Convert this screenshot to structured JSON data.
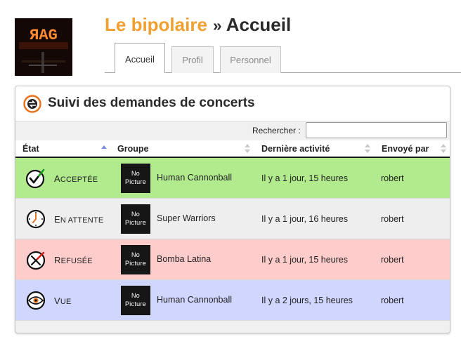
{
  "header": {
    "logo_text": "ЯAG",
    "venue": "Le bipolaire",
    "separator": "»",
    "page": "Accueil"
  },
  "tabs": [
    {
      "label": "Accueil",
      "active": true
    },
    {
      "label": "Profil",
      "active": false
    },
    {
      "label": "Personnel",
      "active": false
    }
  ],
  "panel": {
    "title": "Suivi des demandes de concerts",
    "search": {
      "label": "Rechercher :",
      "value": "",
      "placeholder": ""
    },
    "columns": [
      "État",
      "Groupe",
      "Dernière activité",
      "Envoyé par"
    ],
    "rows": [
      {
        "status_initial": "A",
        "status_rest": "CCEPTÉE",
        "status_icon": "accepted-check-icon",
        "thumb": [
          "No",
          "Picture"
        ],
        "group": "Human Cannonball",
        "activity": "Il y a 1 jour, 15 heures",
        "sender": "robert",
        "color": "#b1eb8d"
      },
      {
        "status_initial": "E",
        "status_rest": "N ATTENTE",
        "status_icon": "pending-clock-icon",
        "thumb": [
          "No",
          "Picture"
        ],
        "group": "Super Warriors",
        "activity": "Il y a 1 jour, 16 heures",
        "sender": "robert",
        "color": "#eeeeee"
      },
      {
        "status_initial": "R",
        "status_rest": "EFUSÉE",
        "status_icon": "refused-cross-icon",
        "thumb": [
          "No",
          "Picture"
        ],
        "group": "Bomba Latina",
        "activity": "Il y a 1 jour, 15 heures",
        "sender": "robert",
        "color": "#ffcccc"
      },
      {
        "status_initial": "V",
        "status_rest": "UE",
        "status_icon": "seen-eye-icon",
        "thumb": [
          "No",
          "Picture"
        ],
        "group": "Human Cannonball",
        "activity": "Il y a 2 jours, 15 heures",
        "sender": "robert",
        "color": "#d1d6ff"
      }
    ]
  },
  "colors": {
    "accent": "#f0a030",
    "accepted": "#b1eb8d",
    "pending": "#eeeeee",
    "refused": "#ffcccc",
    "seen": "#d1d6ff"
  }
}
